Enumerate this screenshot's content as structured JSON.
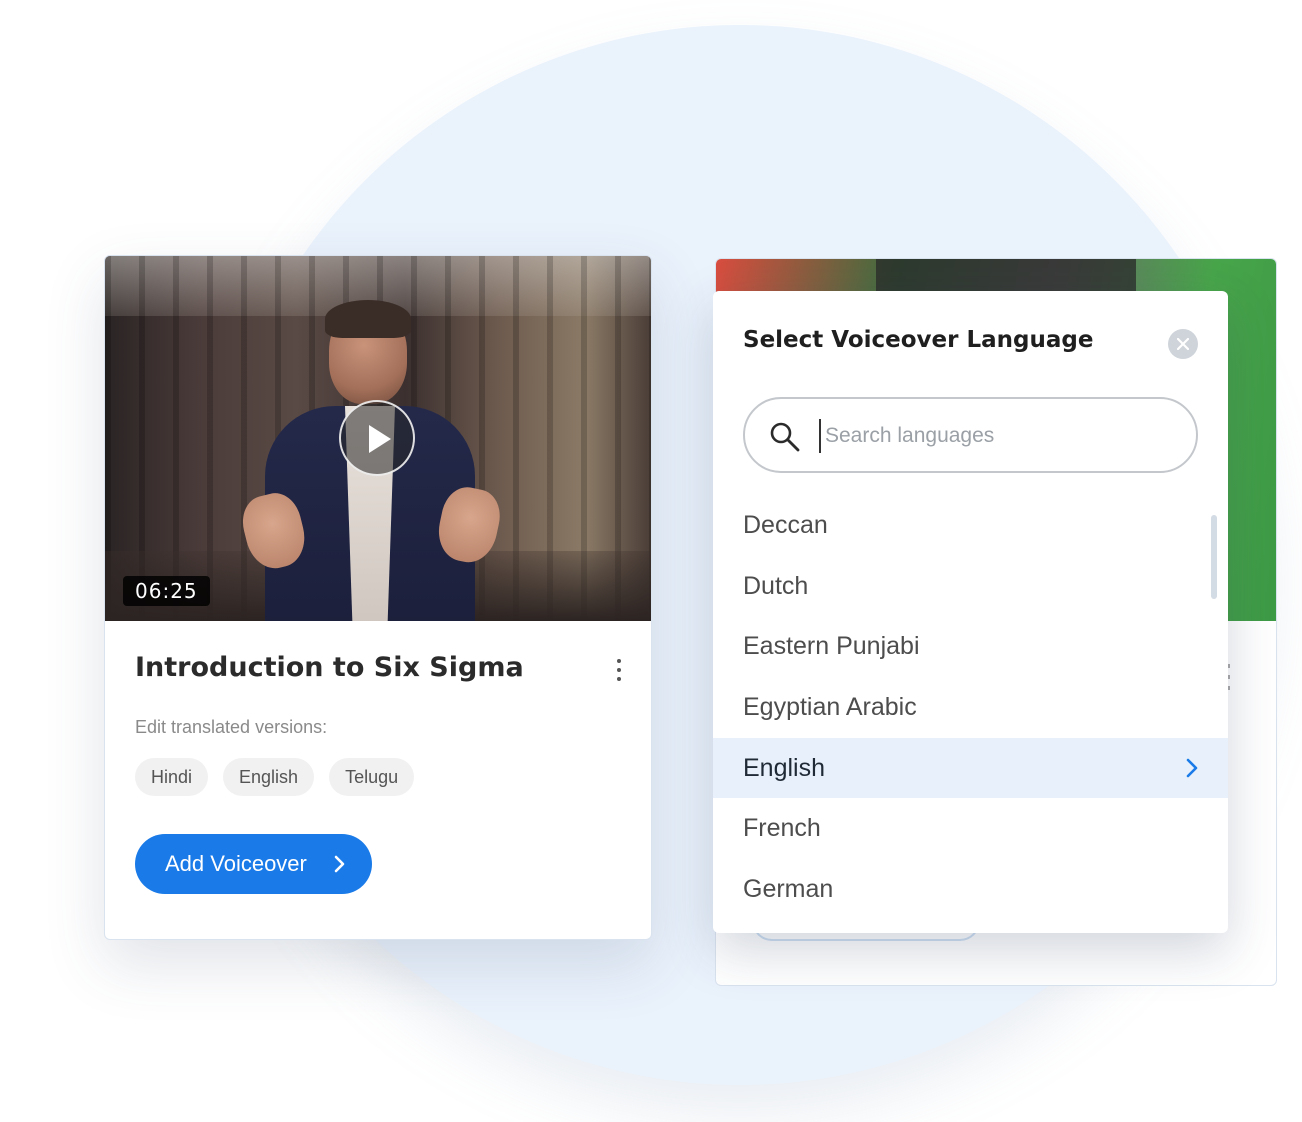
{
  "video_card": {
    "duration": "06:25",
    "title": "Introduction to Six Sigma",
    "edit_label": "Edit translated versions:",
    "translations": [
      "Hindi",
      "English",
      "Telugu"
    ],
    "add_voiceover_label": "Add Voiceover"
  },
  "language_popup": {
    "title": "Select Voiceover Language",
    "search_placeholder": "Search languages",
    "search_value": "",
    "languages": [
      "Deccan",
      "Dutch",
      "Eastern Punjabi",
      "Egyptian Arabic",
      "English",
      "French",
      "German"
    ],
    "selected_language": "English"
  },
  "colors": {
    "primary": "#1a7be8",
    "selected_row": "#e8f1fb",
    "background_circle": "#eaf2fc"
  },
  "icons": {
    "play": "play-icon",
    "more": "kebab-menu-icon",
    "close": "close-icon",
    "search": "search-icon",
    "chevron": "chevron-right-icon"
  }
}
